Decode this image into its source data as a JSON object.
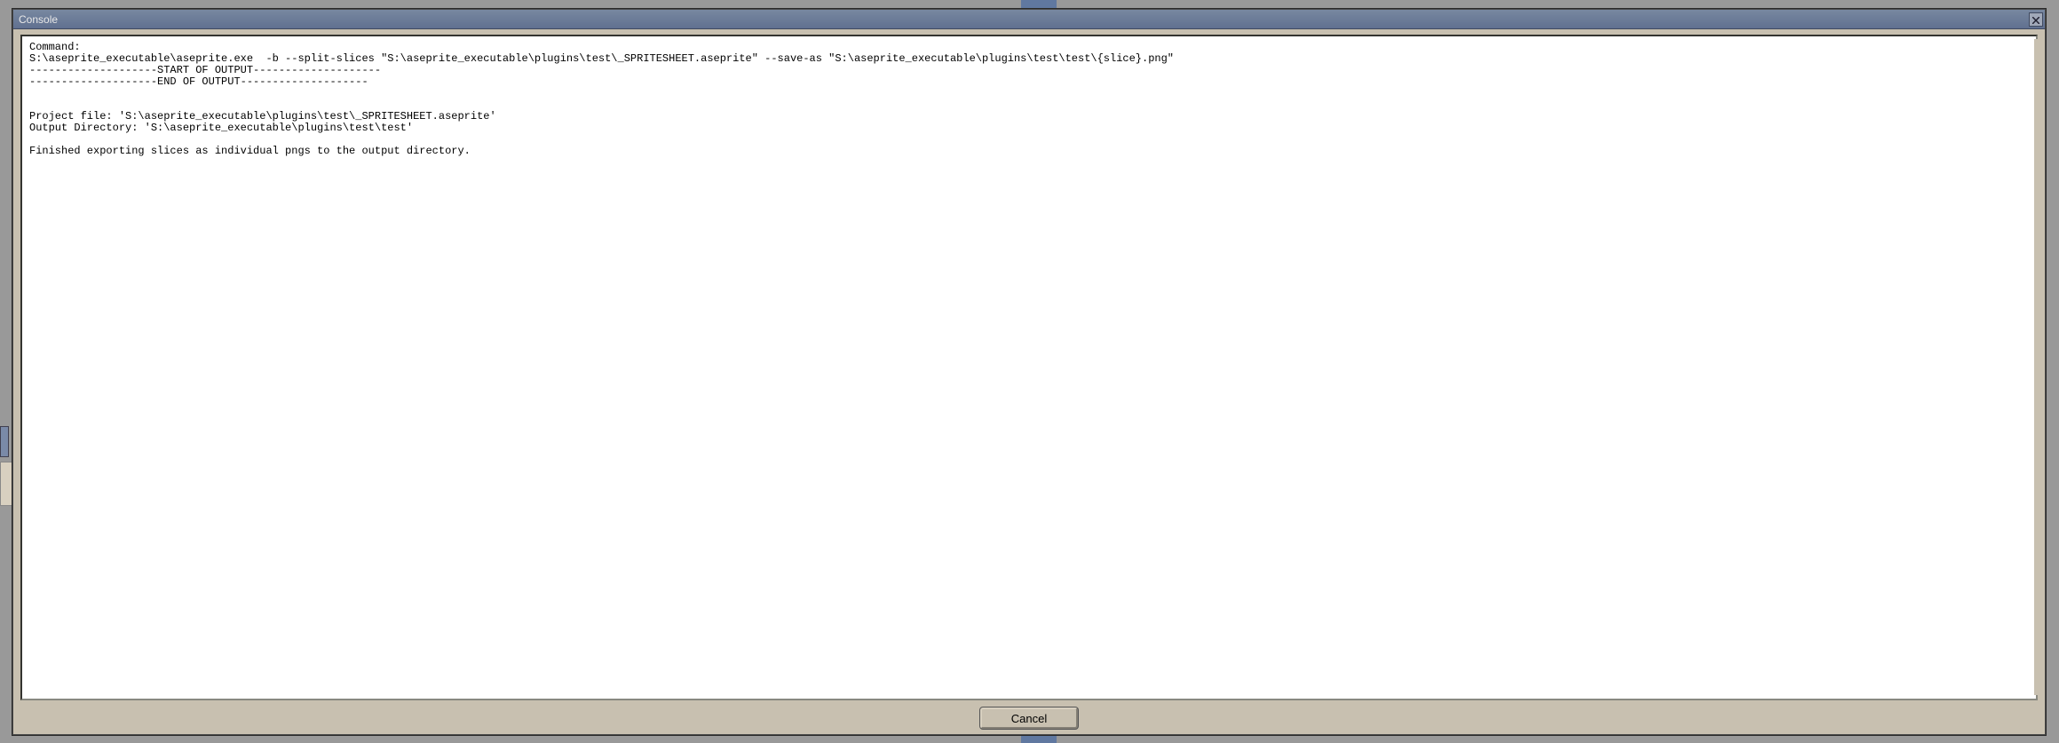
{
  "dialog": {
    "title": "Console",
    "close_label": "Close"
  },
  "console": {
    "lines": [
      "Command:",
      "S:\\aseprite_executable\\aseprite.exe  -b --split-slices \"S:\\aseprite_executable\\plugins\\test\\_SPRITESHEET.aseprite\" --save-as \"S:\\aseprite_executable\\plugins\\test\\test\\{slice}.png\"",
      "--------------------START OF OUTPUT--------------------",
      "--------------------END OF OUTPUT--------------------",
      "",
      "",
      "Project file: 'S:\\aseprite_executable\\plugins\\test\\_SPRITESHEET.aseprite'",
      "Output Directory: 'S:\\aseprite_executable\\plugins\\test\\test'",
      "",
      "Finished exporting slices as individual pngs to the output directory."
    ]
  },
  "buttons": {
    "cancel": "Cancel"
  }
}
